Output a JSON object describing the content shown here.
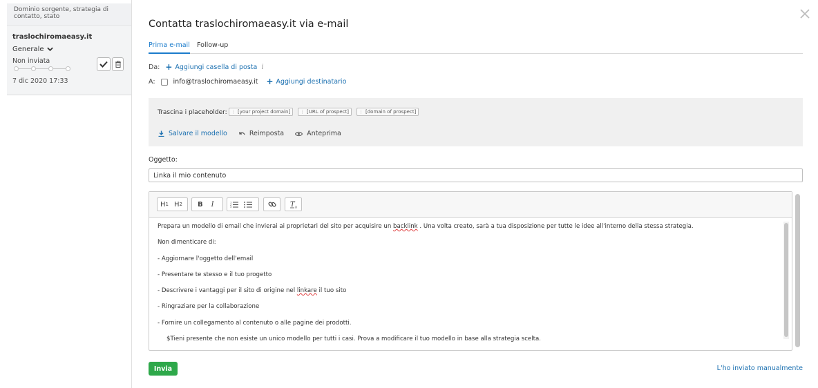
{
  "sidebar": {
    "header_text": "Dominio sorgente, strategia di contatto, stato",
    "card": {
      "domain": "traslochiromaeasy.it",
      "strategy": "Generale",
      "status": "Non inviata",
      "date": "7 dic 2020 17:33",
      "progress_steps": 4
    }
  },
  "modal": {
    "title": "Contatta traslochiromaeasy.it via e-mail",
    "tabs": [
      {
        "label": "Prima e-mail",
        "active": true
      },
      {
        "label": "Follow-up",
        "active": false
      }
    ],
    "from": {
      "label": "Da:",
      "add_mailbox": "Aggiungi casella di posta",
      "info_icon": "i"
    },
    "to": {
      "label": "A:",
      "email": "info@traslochiromaeasy.it",
      "add_recipient": "Aggiungi destinatario"
    },
    "placeholders": {
      "label": "Trascina i placeholder:",
      "chips": [
        "[your project domain]",
        "[URL of prospect]",
        "[domain of prospect]"
      ]
    },
    "actions": {
      "save": "Salvare il modello",
      "reset": "Reimposta",
      "preview": "Anteprima"
    },
    "subject": {
      "label": "Oggetto:",
      "value": "Linka il mio contenuto"
    },
    "editor": {
      "toolbar": [
        "H1",
        "H2",
        "B",
        "I",
        "ordered-list",
        "bullet-list",
        "link",
        "clear-format"
      ],
      "content": {
        "p1_before": "Prepara un modello di email che invierai ai proprietari del sito per acquisire un ",
        "p1_word": "backlink",
        "p1_after": " . Una volta creato, sarà a tua disposizione per tutte le idee all'interno della stessa strategia.",
        "p2": "Non dimenticare di:",
        "p3": "- Aggiornare l'oggetto dell'email",
        "p4": "- Presentare te stesso e il tuo progetto",
        "p5_before": "- Descrivere i vantaggi per il sito di origine nel ",
        "p5_word": "linkare",
        "p5_after": " il tuo sito",
        "p6": "- Ringraziare per la collaborazione",
        "p7": "- Fornire un collegamento al contenuto o alle pagine dei prodotti.",
        "p8": "$Tieni presente che non esiste un unico modello per tutti i casi. Prova a modificare il tuo modello in base alla strategia scelta."
      }
    },
    "send_label": "Invia",
    "manual_label": "L'ho inviato manualmente"
  },
  "colors": {
    "accent": "#1a7bcb",
    "link": "#1a6fb0",
    "send": "#2ea84a"
  }
}
